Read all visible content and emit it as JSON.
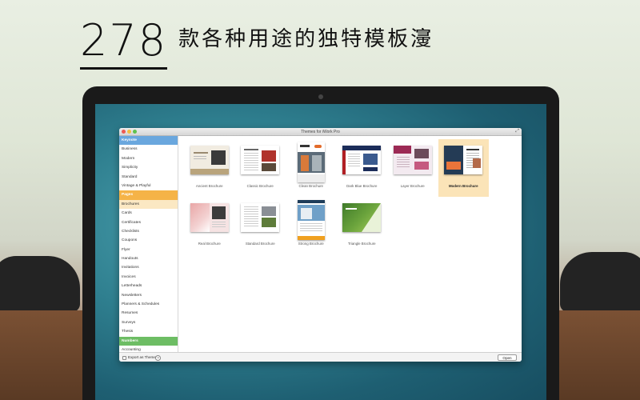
{
  "headline": {
    "number": "278",
    "text": "款各种用途的独特模板濅"
  },
  "window": {
    "title": "Themes for iWork Pro"
  },
  "sidebar": {
    "items": [
      {
        "label": "Keynote",
        "kind": "header-keynote"
      },
      {
        "label": "Business"
      },
      {
        "label": "Modern"
      },
      {
        "label": "Simplicity"
      },
      {
        "label": "Standard"
      },
      {
        "label": "Vintage & Playful"
      },
      {
        "label": "Pages",
        "kind": "header-pages"
      },
      {
        "label": "Brochures",
        "kind": "selected"
      },
      {
        "label": "Cards"
      },
      {
        "label": "Certificates"
      },
      {
        "label": "Checklists"
      },
      {
        "label": "Coupons"
      },
      {
        "label": "Flyer"
      },
      {
        "label": "Handouts"
      },
      {
        "label": "Invitations"
      },
      {
        "label": "Invoices"
      },
      {
        "label": "Letterheads"
      },
      {
        "label": "Newsletters"
      },
      {
        "label": "Planners & Schedules"
      },
      {
        "label": "Resumes"
      },
      {
        "label": "Surveys"
      },
      {
        "label": "Thesis"
      },
      {
        "label": "Numbers",
        "kind": "header-numbers"
      },
      {
        "label": "Accounting"
      }
    ]
  },
  "templates": [
    {
      "label": "Ancient Brochure"
    },
    {
      "label": "Classic Brochure"
    },
    {
      "label": "Clean Brochure"
    },
    {
      "label": "Dark Blue Brochure"
    },
    {
      "label": "Layer Brochure"
    },
    {
      "label": "Modern Brochure",
      "selected": true
    },
    {
      "label": "Real Brochure"
    },
    {
      "label": "Standard Brochure"
    },
    {
      "label": "Strong Brochure"
    },
    {
      "label": "Triangle Brochure"
    }
  ],
  "bottom": {
    "export_label": "Export as Theme",
    "help": "?",
    "open_label": "Open"
  },
  "colors": {
    "keynote": "#6aa7de",
    "pages": "#f5b347",
    "numbers": "#6dbd64",
    "selection": "#fbe4b8"
  }
}
